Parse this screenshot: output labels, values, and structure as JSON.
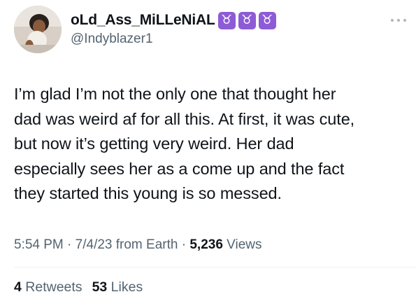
{
  "author": {
    "display_name": "oLd_Ass_MiLLeNiAL",
    "badges": [
      "♉",
      "♉",
      "♉"
    ],
    "handle": "@Indyblazer1"
  },
  "icons": {
    "avatar": "profile-photo",
    "more": "more-horizontal-icon",
    "badge": "taurus-emoji"
  },
  "tweet": {
    "lines": [
      "I’m glad I’m not the only one that thought her",
      "dad was weird af for all this. At first, it was cute,",
      "but now it’s getting very weird. Her dad",
      "especially sees her as a come up and the fact",
      "they started this young is so messed."
    ]
  },
  "meta": {
    "time": "5:54 PM",
    "sep1": " · ",
    "date": "7/4/23",
    "source": " from Earth",
    "sep2": " · ",
    "views_count": "5,236",
    "views_label": " Views"
  },
  "stats": {
    "retweets_count": "4",
    "retweets_label": " Retweets",
    "likes_count": "53",
    "likes_label": " Likes"
  },
  "colors": {
    "text_primary": "#0f1419",
    "text_secondary": "#536471",
    "badge_purple": "#8e5bd6",
    "divider": "#eff3f4"
  }
}
